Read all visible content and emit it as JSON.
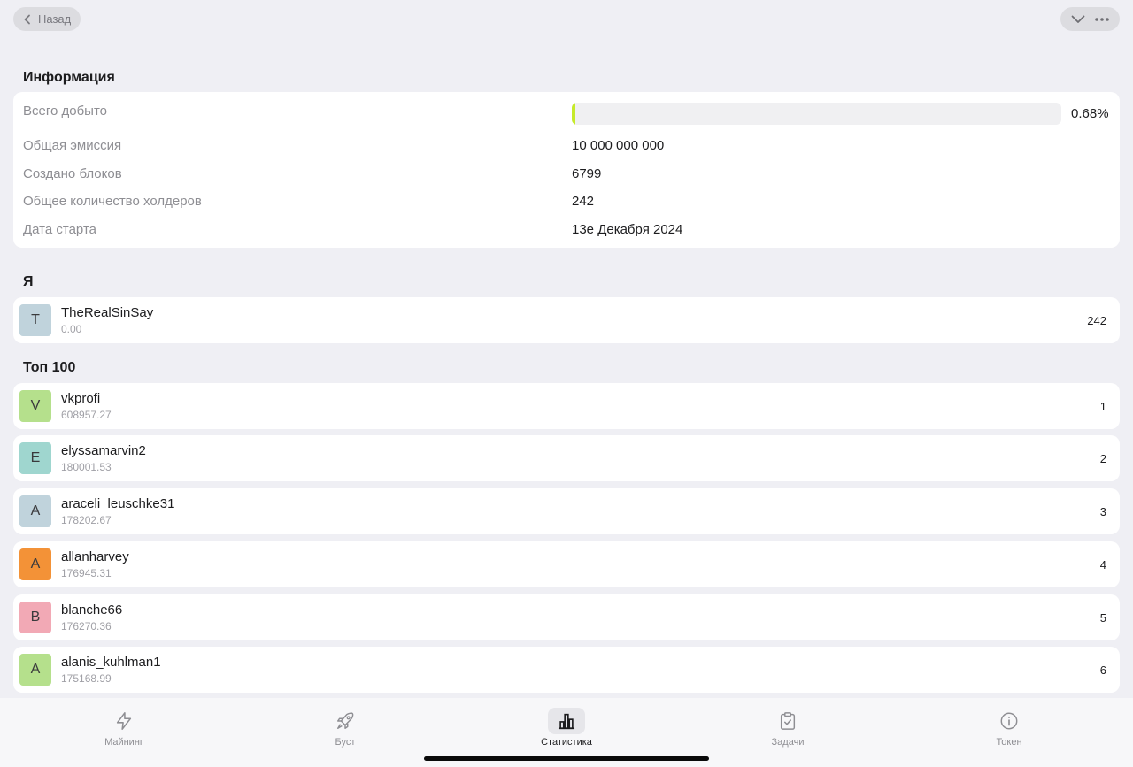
{
  "header": {
    "back_label": "Назад"
  },
  "info": {
    "title": "Информация",
    "mined_label": "Всего добыто",
    "mined_pct_text": "0.68%",
    "mined_fraction": 0.0068,
    "accent_color": "#c6ea2a",
    "rows": [
      {
        "label": "Общая эмиссия",
        "value": "10 000 000 000"
      },
      {
        "label": "Создано блоков",
        "value": "6799"
      },
      {
        "label": "Общее количество холдеров",
        "value": "242"
      },
      {
        "label": "Дата старта",
        "value": "13е Декабря 2024"
      }
    ]
  },
  "me": {
    "title": "Я",
    "user": {
      "initial": "T",
      "name": "TheRealSinSay",
      "score": "0.00",
      "rank": "242",
      "avatar_color": "#c0d3dc"
    }
  },
  "top": {
    "title": "Топ 100",
    "users": [
      {
        "initial": "V",
        "name": "vkprofi",
        "score": "608957.27",
        "rank": "1",
        "avatar_color": "#b5e08c"
      },
      {
        "initial": "E",
        "name": "elyssamarvin2",
        "score": "180001.53",
        "rank": "2",
        "avatar_color": "#9fd6cf"
      },
      {
        "initial": "A",
        "name": "araceli_leuschke31",
        "score": "178202.67",
        "rank": "3",
        "avatar_color": "#c0d3dc"
      },
      {
        "initial": "A",
        "name": "allanharvey",
        "score": "176945.31",
        "rank": "4",
        "avatar_color": "#f39237"
      },
      {
        "initial": "B",
        "name": "blanche66",
        "score": "176270.36",
        "rank": "5",
        "avatar_color": "#f2a9b5"
      },
      {
        "initial": "A",
        "name": "alanis_kuhlman1",
        "score": "175168.99",
        "rank": "6",
        "avatar_color": "#b5e08c"
      }
    ]
  },
  "nav": {
    "items": [
      {
        "label": "Майнинг",
        "icon": "lightning-icon"
      },
      {
        "label": "Буст",
        "icon": "rocket-icon"
      },
      {
        "label": "Статистика",
        "icon": "bar-chart-icon"
      },
      {
        "label": "Задачи",
        "icon": "clipboard-check-icon"
      },
      {
        "label": "Токен",
        "icon": "info-icon"
      }
    ],
    "active_index": 2
  }
}
